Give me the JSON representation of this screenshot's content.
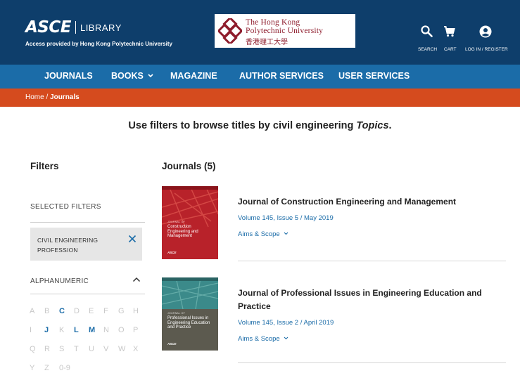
{
  "header": {
    "logo_main": "ASCE",
    "logo_sub": "LIBRARY",
    "access_text": "Access provided by Hong Kong Polytechnic University",
    "institution_logo": {
      "line1": "The Hong Kong",
      "line2": "Polytechnic University",
      "line3": "香港理工大學"
    },
    "icons": [
      {
        "icon": "search-icon",
        "label": "SEARCH"
      },
      {
        "icon": "cart-icon",
        "label": "CART"
      },
      {
        "icon": "account-icon",
        "label": "LOG IN / REGISTER"
      }
    ]
  },
  "nav": {
    "items": [
      {
        "label": "JOURNALS"
      },
      {
        "label": "BOOKS",
        "has_dropdown": true
      },
      {
        "label": "MAGAZINE"
      },
      {
        "label": "AUTHOR SERVICES"
      },
      {
        "label": "USER SERVICES"
      }
    ]
  },
  "breadcrumb": {
    "home": "Home",
    "separator": " / ",
    "current": "Journals"
  },
  "headline": {
    "text": "Use filters to browse titles by civil engineering ",
    "emphasis": "Topics",
    "suffix": "."
  },
  "filters": {
    "title": "Filters",
    "selected_heading": "SELECTED FILTERS",
    "selected": [
      {
        "label": "CIVIL ENGINEERING PROFESSION"
      }
    ],
    "alphanumeric_heading": "ALPHANUMERIC",
    "letters": [
      [
        "A",
        "B",
        "C",
        "D",
        "E",
        "F",
        "G",
        "H"
      ],
      [
        "I",
        "J",
        "K",
        "L",
        "M",
        "N",
        "O",
        "P"
      ],
      [
        "Q",
        "R",
        "S",
        "T",
        "U",
        "V",
        "W",
        "X"
      ],
      [
        "Y",
        "Z",
        "0-9"
      ]
    ],
    "active_letters": [
      "C",
      "J",
      "L",
      "M"
    ]
  },
  "results": {
    "title": "Journals (5)",
    "items": [
      {
        "title": "Journal of Construction Engineering and Management",
        "issue": "Volume 145, Issue 5 / May 2019",
        "aims": "Aims & Scope",
        "cover": {
          "small": "JOURNAL OF",
          "title": "Construction Engineering and Management",
          "mark": "ASCE",
          "color": "#b8222a"
        }
      },
      {
        "title": "Journal of Professional Issues in Engineering Education and Practice",
        "issue": "Volume 145, Issue 2 / April 2019",
        "aims": "Aims & Scope",
        "cover": {
          "small": "JOURNAL OF",
          "title": "Professional Issues in Engineering Education and Practice",
          "mark": "ASCE",
          "color": "#5c5a4f"
        }
      }
    ]
  },
  "colors": {
    "header": "#0e3e6b",
    "nav": "#1b6ca8",
    "breadcrumb": "#d54b1e",
    "link": "#1b6ca8"
  }
}
